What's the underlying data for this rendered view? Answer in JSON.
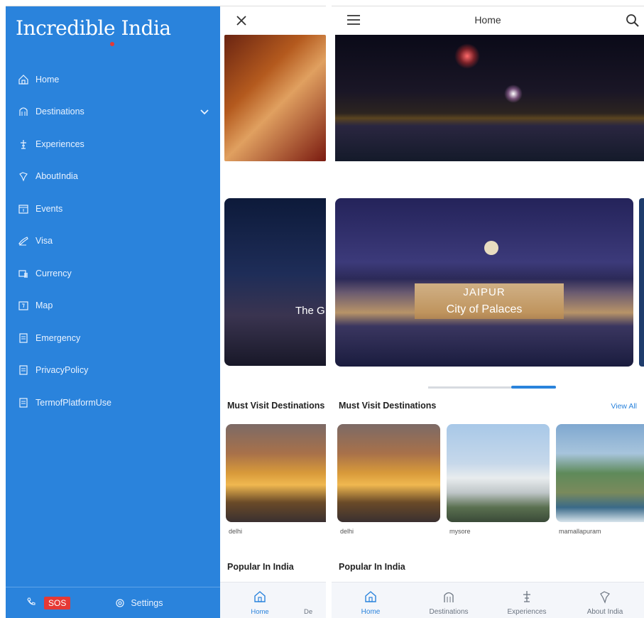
{
  "app": {
    "logo_text": "Incredible India",
    "accent": "#2a83dc"
  },
  "drawer": {
    "items": [
      {
        "label": "Home"
      },
      {
        "label": "Destinations"
      },
      {
        "label": "Experiences"
      },
      {
        "label": "AboutIndia"
      },
      {
        "label": "Events"
      },
      {
        "label": "Visa"
      },
      {
        "label": "Currency"
      },
      {
        "label": "Map"
      },
      {
        "label": "Emergency"
      },
      {
        "label": "PrivacyPolicy"
      },
      {
        "label": "TermofPlatformUse"
      }
    ],
    "footer": {
      "sos_label": "SOS",
      "settings_label": "Settings"
    }
  },
  "left_content": {
    "card_overlay": "The G",
    "section_title": "Must Visit Destinations",
    "caption": "delhi",
    "popular_title": "Popular In India",
    "nav": {
      "home": "Home",
      "dest_partial": "De"
    }
  },
  "right": {
    "appbar_title": "Home",
    "featured": {
      "city": "JAIPUR",
      "tagline": "City of Palaces"
    },
    "section_title": "Must Visit Destinations",
    "view_all": "View All",
    "destinations": [
      {
        "caption": "delhi"
      },
      {
        "caption": "mysore"
      },
      {
        "caption": "mamallapuram"
      }
    ],
    "popular_title": "Popular In India",
    "nav": [
      {
        "label": "Home",
        "icon": "home-icon",
        "active": true
      },
      {
        "label": "Destinations",
        "icon": "destinations-icon",
        "active": false
      },
      {
        "label": "Experiences",
        "icon": "experiences-icon",
        "active": false
      },
      {
        "label": "About India",
        "icon": "map-pin-icon",
        "active": false
      }
    ]
  }
}
